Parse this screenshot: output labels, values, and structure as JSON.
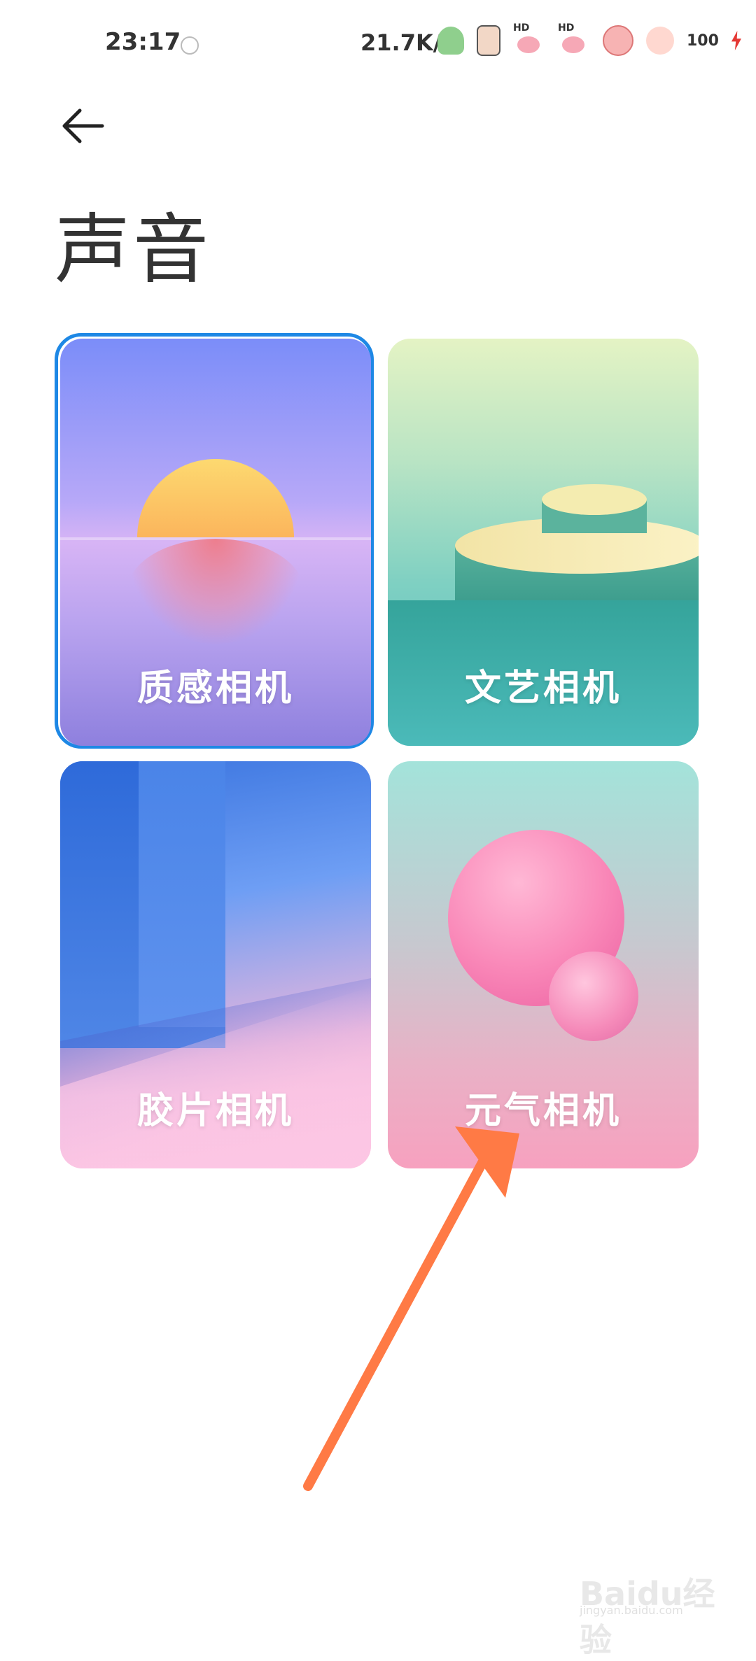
{
  "status_bar": {
    "time": "23:17",
    "net_speed": "21.7K/s",
    "battery": "100"
  },
  "header": {
    "title": "声音"
  },
  "cards": [
    {
      "label": "质感相机",
      "selected": true
    },
    {
      "label": "文艺相机",
      "selected": false
    },
    {
      "label": "胶片相机",
      "selected": false
    },
    {
      "label": "元气相机",
      "selected": false
    }
  ],
  "annotation": {
    "color": "#ff7a45"
  },
  "watermark": {
    "brand": "Baidu经验",
    "url": "jingyan.baidu.com"
  }
}
